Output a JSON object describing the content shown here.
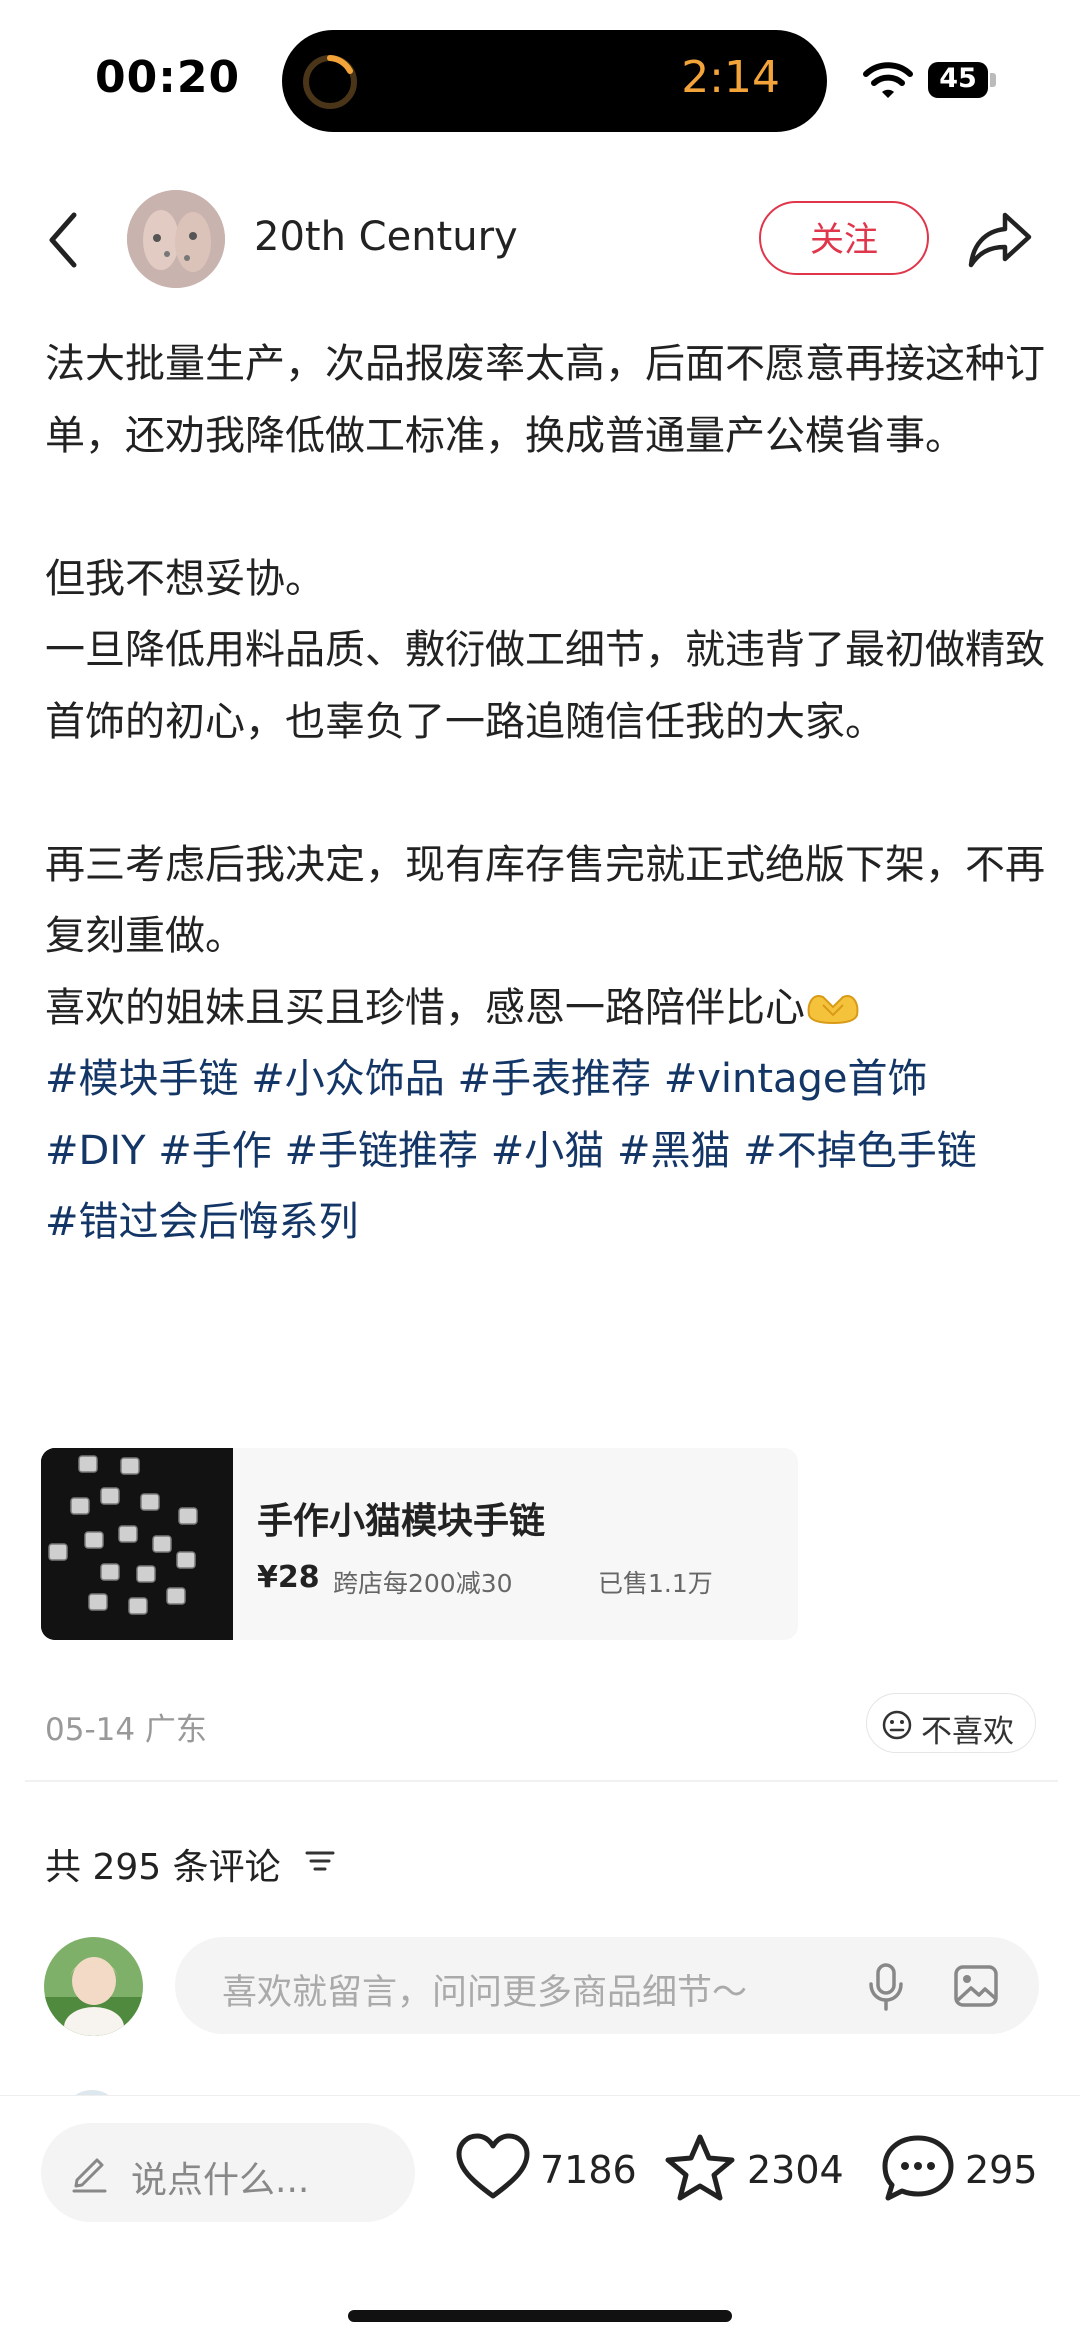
{
  "status_bar": {
    "time": "00:20",
    "island_timer": "2:14",
    "battery": "45"
  },
  "header": {
    "author_name": "20th Century",
    "follow_label": "关注"
  },
  "post": {
    "paragraphs": [
      "法大批量生产，次品报废率太高，后面不愿意再接这种订单，还劝我降低做工标准，换成普通量产公模省事。",
      "但我不想妥协。",
      "一旦降低用料品质、敷衍做工细节，就违背了最初做精致首饰的初心，也辜负了一路追随信任我的大家。",
      "再三考虑后我决定，现有库存售完就正式绝版下架，不再复刻重做。",
      "喜欢的姐妹且买且珍惜，感恩一路陪伴比心"
    ],
    "tags_line1": "#模块手链 #小众饰品  #手表推荐 #vintage首饰",
    "tags_line2": "#DIY #手作 #手链推荐 #小猫 #黑猫 #不掉色手链",
    "tags_line3": "#错过会后悔系列"
  },
  "product": {
    "title": "手作小猫模块手链",
    "price": "¥28",
    "promo": "跨店每200减30",
    "sold": "已售1.1万"
  },
  "meta": {
    "date_location": "05-14 广东",
    "dislike_label": "不喜欢"
  },
  "comments": {
    "count_label": "共 295 条评论",
    "input_placeholder": "喜欢就留言，问问更多商品细节～"
  },
  "bottom_bar": {
    "say_placeholder": "说点什么...",
    "likes": "7186",
    "stars": "2304",
    "comments": "295"
  },
  "colors": {
    "accent_red": "#e0364b",
    "tag_blue": "#133667",
    "timer_orange": "#f2a33a"
  }
}
